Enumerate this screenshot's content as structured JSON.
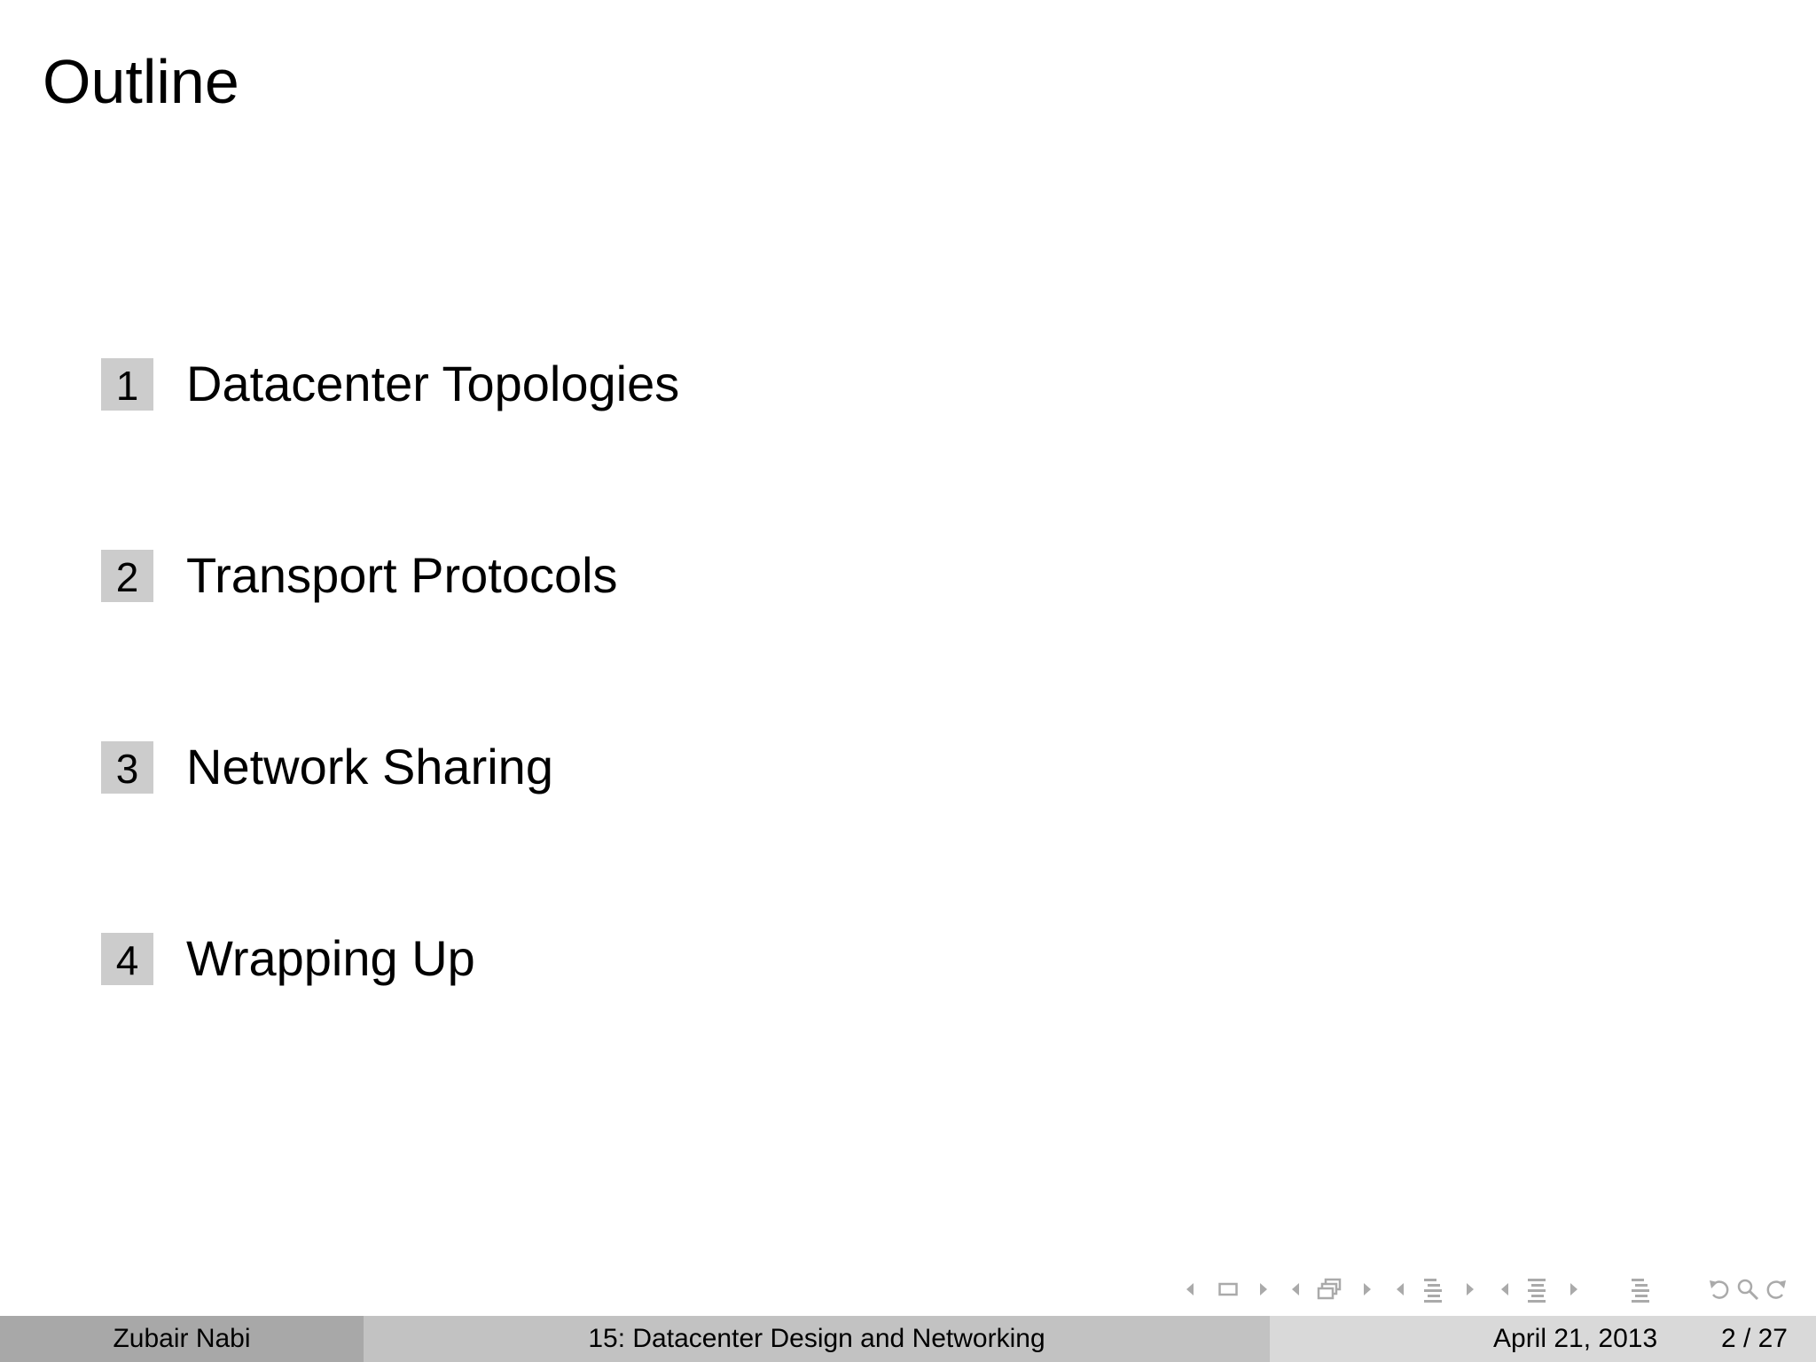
{
  "slide": {
    "title": "Outline"
  },
  "toc": {
    "items": [
      {
        "number": "1",
        "label": "Datacenter Topologies"
      },
      {
        "number": "2",
        "label": "Transport Protocols"
      },
      {
        "number": "3",
        "label": "Network Sharing"
      },
      {
        "number": "4",
        "label": "Wrapping Up"
      }
    ]
  },
  "navigation": {
    "icons": [
      "arrow-left-icon",
      "frame-icon",
      "arrow-right-icon",
      "arrow-left-icon",
      "subsection-icon",
      "arrow-right-icon",
      "arrow-left-icon",
      "section-icon",
      "arrow-right-icon",
      "arrow-left-icon",
      "presentation-icon",
      "arrow-right-icon",
      "appendix-icon",
      "back-icon",
      "search-icon",
      "forward-icon"
    ]
  },
  "footer": {
    "author": "Zubair Nabi",
    "title": "15: Datacenter Design and Networking",
    "date": "April 21, 2013",
    "page": "2 / 27"
  },
  "colors": {
    "number_box": "#cccccc",
    "footer_author_bg": "#a8a8a8",
    "footer_title_bg": "#c2c2c2",
    "footer_right_bg": "#d9d9d9",
    "nav_icon": "#aaaaaa"
  }
}
